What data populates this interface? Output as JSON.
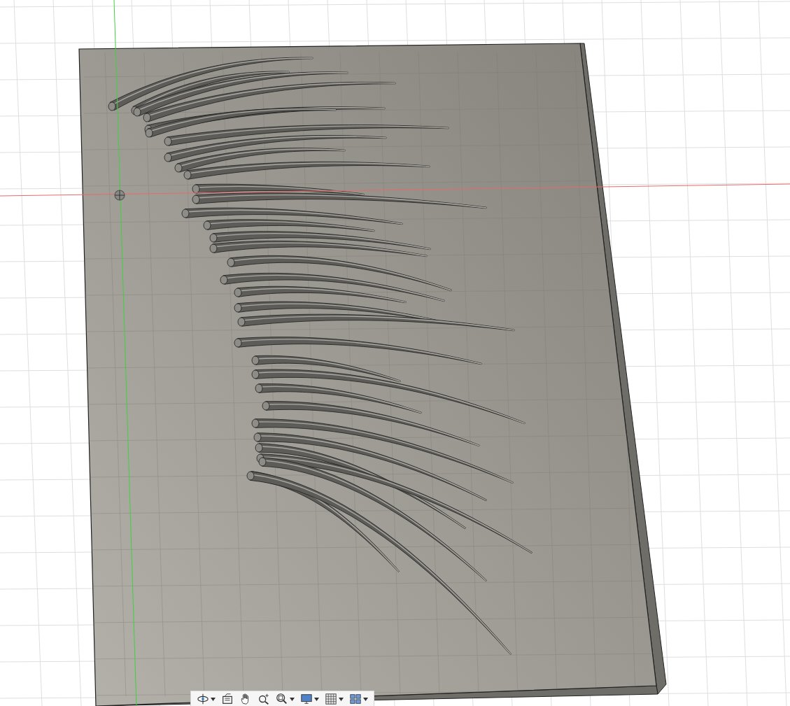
{
  "toolbar": {
    "tools": [
      {
        "kind": "orbit",
        "dropdown": true
      },
      {
        "kind": "look_at",
        "dropdown": false
      },
      {
        "kind": "pan",
        "dropdown": false
      },
      {
        "kind": "zoom",
        "dropdown": false
      },
      {
        "kind": "fit",
        "dropdown": true
      },
      {
        "kind": "display",
        "dropdown": true
      },
      {
        "kind": "grid",
        "dropdown": true
      },
      {
        "kind": "viewports",
        "dropdown": true
      }
    ]
  }
}
